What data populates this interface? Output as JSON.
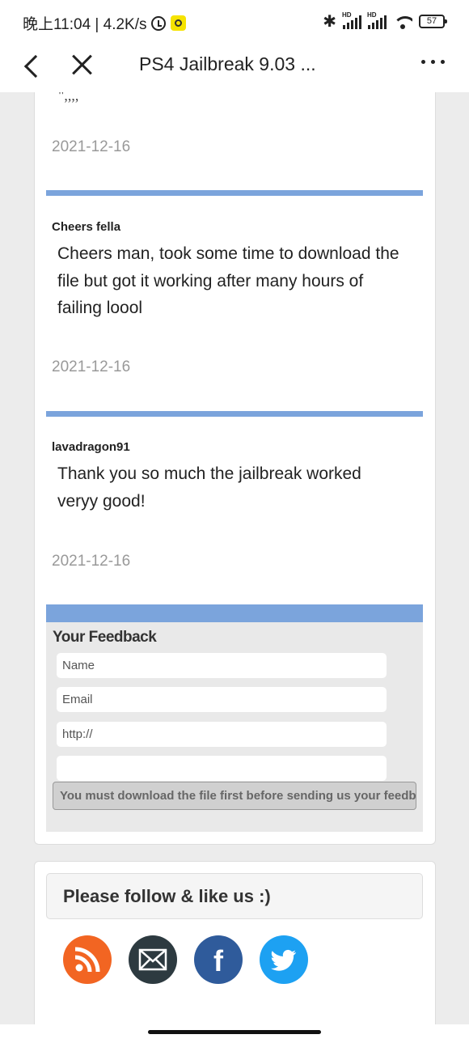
{
  "status_bar": {
    "time_text": "晚上11:04 | 4.2K/s",
    "battery": "57"
  },
  "nav": {
    "title": "PS4 Jailbreak 9.03 ..."
  },
  "comments": {
    "partial_text": "\",,,,",
    "items": [
      {
        "author": "",
        "text": "",
        "date": "2021-12-16"
      },
      {
        "author": "Cheers fella",
        "text": "Cheers man, took some time to download the file but got it working after many hours of failing loool",
        "date": "2021-12-16"
      },
      {
        "author": "lavadragon91",
        "text": "Thank you so much the jailbreak worked veryy good!",
        "date": "2021-12-16"
      }
    ]
  },
  "feedback": {
    "title": "Your Feedback",
    "name_placeholder": "Name",
    "email_placeholder": "Email",
    "url_value": "http://",
    "comment_value": "",
    "submit_label": "You must download the file first before sending us your feedback"
  },
  "follow": {
    "title": "Please follow & like us :)",
    "icons": [
      "rss-icon",
      "email-icon",
      "facebook-icon",
      "twitter-icon"
    ],
    "colors": {
      "rss": "#f26522",
      "email": "#2d3a40",
      "facebook": "#2f5b9b",
      "twitter": "#1da1f2"
    }
  },
  "colors": {
    "divider": "#7ba4dc",
    "date": "#999999"
  }
}
